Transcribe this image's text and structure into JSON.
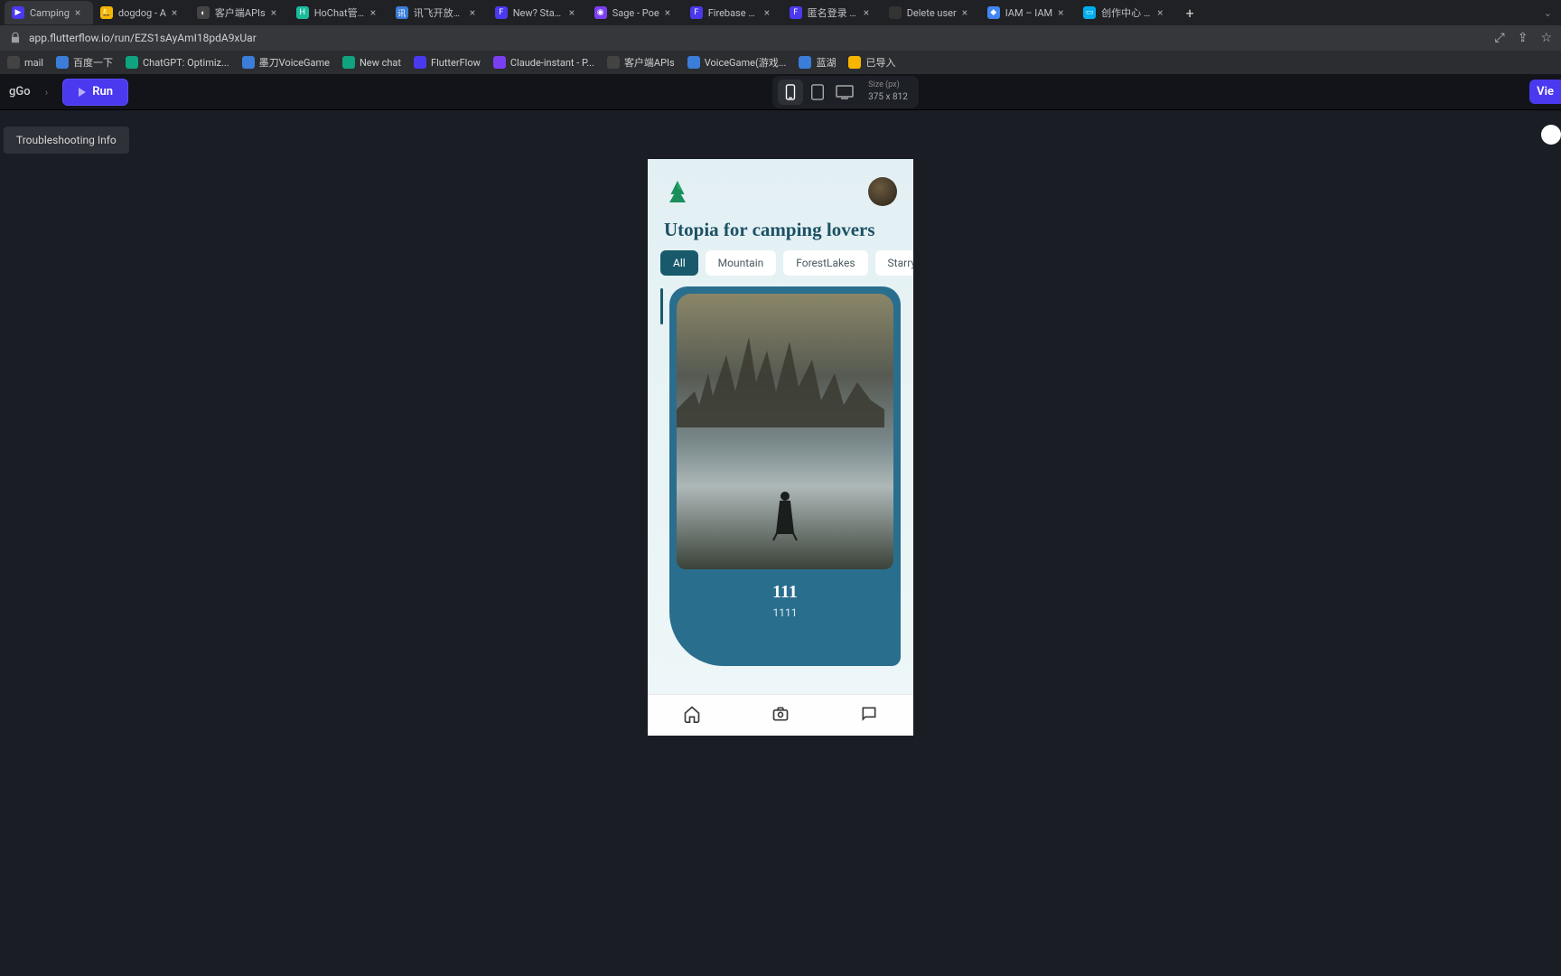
{
  "browser": {
    "tabs": [
      {
        "title": "Camping",
        "favicon_bg": "#4b39ef",
        "favicon_text": "▶"
      },
      {
        "title": "dogdog - A",
        "favicon_bg": "#f7b500",
        "favicon_text": "🔔"
      },
      {
        "title": "客户端APIs",
        "favicon_bg": "#444",
        "favicon_text": "◐"
      },
      {
        "title": "HoChat管理",
        "favicon_bg": "#1abc9c",
        "favicon_text": "H"
      },
      {
        "title": "讯飞开放平台",
        "favicon_bg": "#3b7dd8",
        "favicon_text": "讯"
      },
      {
        "title": "New? Start I",
        "favicon_bg": "#4b39ef",
        "favicon_text": "F"
      },
      {
        "title": "Sage - Poe",
        "favicon_bg": "#7b3ff2",
        "favicon_text": "◉"
      },
      {
        "title": "Firebase Set",
        "favicon_bg": "#4b39ef",
        "favicon_text": "F"
      },
      {
        "title": "匿名登录 - FI",
        "favicon_bg": "#4b39ef",
        "favicon_text": "F"
      },
      {
        "title": "Delete user",
        "favicon_bg": "#333",
        "favicon_text": ""
      },
      {
        "title": "IAM – IAM",
        "favicon_bg": "#4285f4",
        "favicon_text": "◆"
      },
      {
        "title": "创作中心 - 投",
        "favicon_bg": "#00aeec",
        "favicon_text": "▭"
      }
    ],
    "url": "app.flutterflow.io/run/EZS1sAyAmI18pdA9xUar"
  },
  "bookmarks": [
    {
      "label": "mail",
      "bg": "#444"
    },
    {
      "label": "百度一下",
      "bg": "#3b7dd8"
    },
    {
      "label": "ChatGPT: Optimiz...",
      "bg": "#10a37f"
    },
    {
      "label": "墨刀VoiceGame",
      "bg": "#3b7dd8"
    },
    {
      "label": "New chat",
      "bg": "#10a37f"
    },
    {
      "label": "FlutterFlow",
      "bg": "#4b39ef"
    },
    {
      "label": "Claude-instant - P...",
      "bg": "#7b3ff2"
    },
    {
      "label": "客户端APIs",
      "bg": "#444"
    },
    {
      "label": "VoiceGame(游戏...",
      "bg": "#3b7dd8"
    },
    {
      "label": "蓝湖",
      "bg": "#3b7dd8"
    },
    {
      "label": "已导入",
      "bg": "#f7b500"
    }
  ],
  "toolbar": {
    "project_name": "gGo",
    "run_label": "Run",
    "size_label": "Size (px)",
    "size_value": "375 x 812",
    "view_label": "Vie",
    "troubleshoot": "Troubleshooting Info"
  },
  "app": {
    "title": "Utopia for camping lovers",
    "chips": [
      "All",
      "Mountain",
      "ForestLakes",
      "Starry"
    ],
    "card": {
      "title": "111",
      "subtitle": "1111"
    }
  }
}
